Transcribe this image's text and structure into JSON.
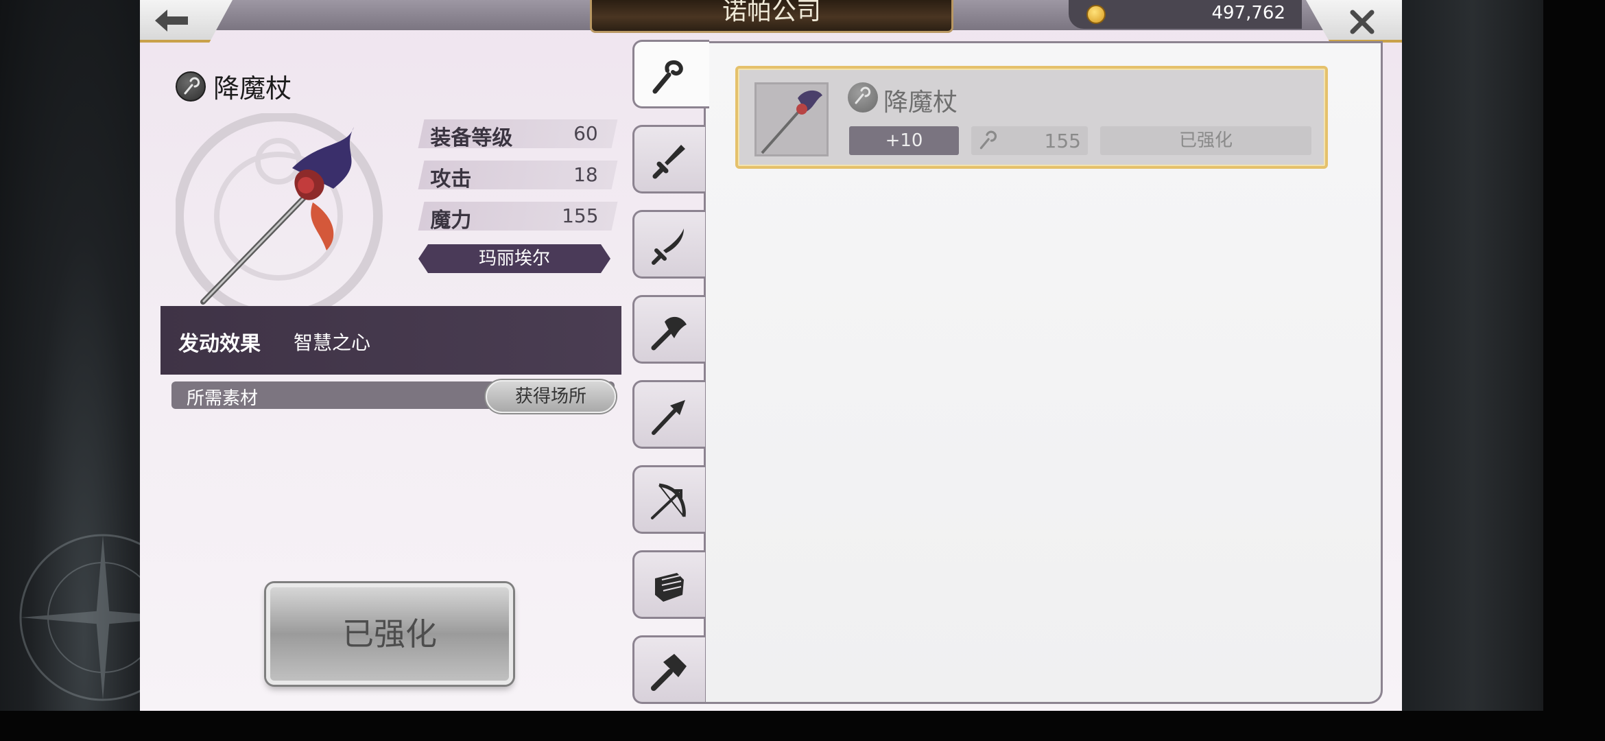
{
  "header": {
    "title": "诺帕公司",
    "currency_value": "497,762",
    "back_icon": "back-arrow-icon",
    "close_icon": "close-icon"
  },
  "weapon": {
    "name": "降魔杖",
    "stats": [
      {
        "label": "装备等级",
        "value": "60"
      },
      {
        "label": "攻击",
        "value": "18"
      },
      {
        "label": "魔力",
        "value": "155"
      }
    ],
    "owner": "玛丽埃尔",
    "effect_label": "发动效果",
    "effect_value": "智慧之心",
    "materials_label": "所需素材",
    "obtain_button": "获得场所",
    "action_button": "已强化"
  },
  "tabs": [
    {
      "icon": "staff-icon",
      "active": true
    },
    {
      "icon": "sword-icon",
      "active": false
    },
    {
      "icon": "blade-icon",
      "active": false
    },
    {
      "icon": "axe-icon",
      "active": false
    },
    {
      "icon": "spear-icon",
      "active": false
    },
    {
      "icon": "bow-icon",
      "active": false
    },
    {
      "icon": "fist-icon",
      "active": false
    },
    {
      "icon": "hammer-icon",
      "active": false
    }
  ],
  "list": {
    "items": [
      {
        "name": "降魔杖",
        "level": "+10",
        "magic": "155",
        "status": "已强化"
      }
    ]
  },
  "colors": {
    "accent_gold": "#e5c16b",
    "panel_purple": "#4a3d52",
    "owner_purple": "#4a3a58"
  }
}
